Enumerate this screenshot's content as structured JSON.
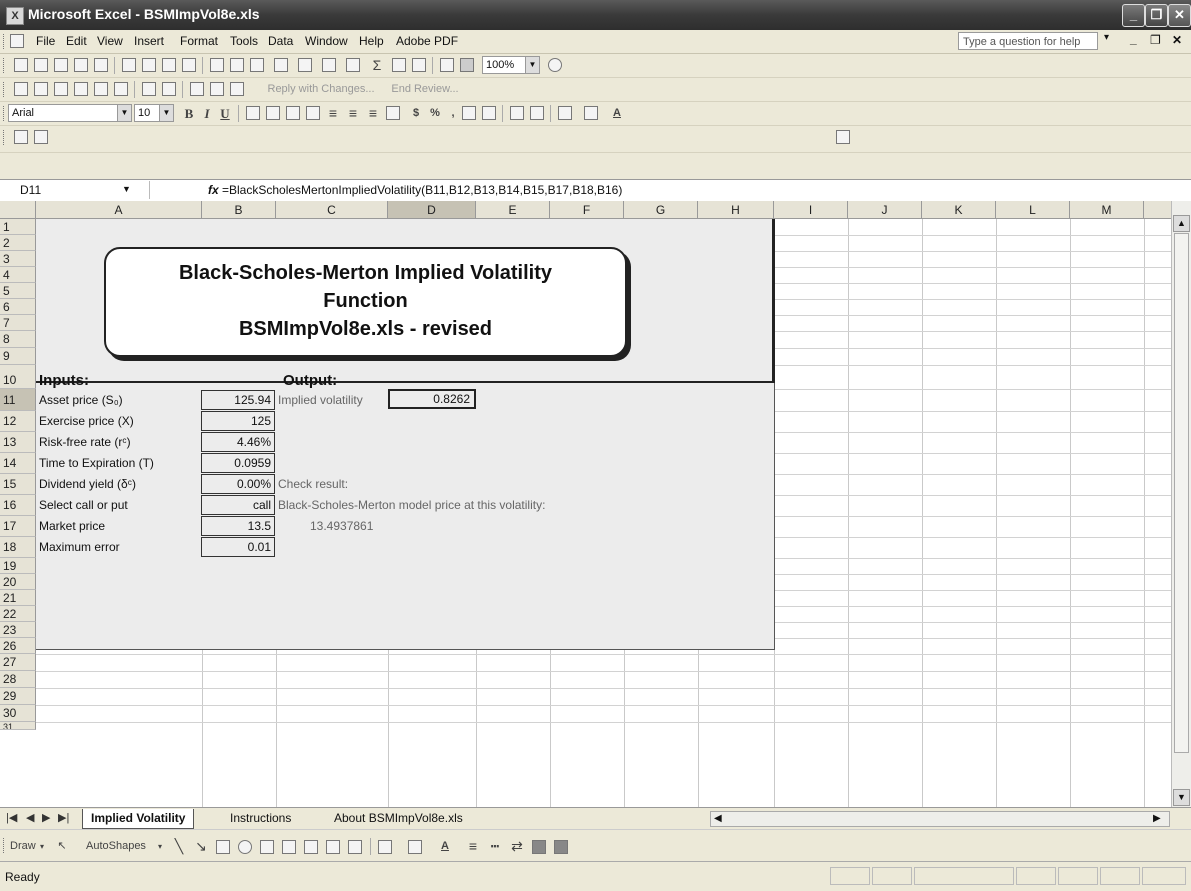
{
  "window": {
    "title": "Microsoft Excel - BSMImpVol8e.xls"
  },
  "menu": {
    "items": [
      "File",
      "Edit",
      "View",
      "Insert",
      "Format",
      "Tools",
      "Data",
      "Window",
      "Help",
      "Adobe PDF"
    ],
    "help_placeholder": "Type a question for help"
  },
  "toolbar": {
    "zoom": "100%",
    "reply_label": "Reply with Changes...",
    "end_review": "End Review...",
    "font_name": "Arial",
    "font_size": "10",
    "bold": "B",
    "italic": "I",
    "underline": "U",
    "currency": "$",
    "percent": "%",
    "comma": ","
  },
  "formula_bar": {
    "cell_ref": "D11",
    "fx": "fx",
    "formula": "=BlackScholesMertonImpliedVolatility(B11,B12,B13,B14,B15,B17,B18,B16)"
  },
  "columns": [
    "A",
    "B",
    "C",
    "D",
    "E",
    "F",
    "G",
    "H",
    "I",
    "J",
    "K",
    "L",
    "M"
  ],
  "rows": [
    "1",
    "2",
    "3",
    "4",
    "5",
    "6",
    "7",
    "8",
    "9",
    "10",
    "11",
    "12",
    "13",
    "14",
    "15",
    "16",
    "17",
    "18",
    "19",
    "20",
    "21",
    "22",
    "23",
    "26",
    "27",
    "28",
    "29",
    "30",
    "31"
  ],
  "sheet": {
    "title_line1": "Black-Scholes-Merton Implied Volatility",
    "title_line2": "Function",
    "title_line3": "BSMImpVol8e.xls - revised",
    "inputs_header": "Inputs:",
    "output_header": "Output:",
    "inputs": [
      {
        "label": "Asset price (S₀)",
        "value": "125.94"
      },
      {
        "label": "Exercise price (X)",
        "value": "125"
      },
      {
        "label": "Risk-free rate (rᶜ)",
        "value": "4.46%"
      },
      {
        "label": "Time to Expiration (T)",
        "value": "0.0959"
      },
      {
        "label": "Dividend yield (δᶜ)",
        "value": "0.00%"
      },
      {
        "label": "Select call or put",
        "value": "call"
      },
      {
        "label": "Market price",
        "value": "13.5"
      },
      {
        "label": "Maximum error",
        "value": "0.01"
      }
    ],
    "output_label": "Implied volatility",
    "output_value": "0.8262",
    "check_label": "Check result:",
    "model_label": "Black-Scholes-Merton model price at this volatility:",
    "model_price": "13.4937861"
  },
  "tabs": [
    "Implied Volatility",
    "Instructions",
    "About BSMImpVol8e.xls"
  ],
  "drawbar": {
    "draw": "Draw",
    "autoshapes": "AutoShapes"
  },
  "status": {
    "text": "Ready"
  }
}
